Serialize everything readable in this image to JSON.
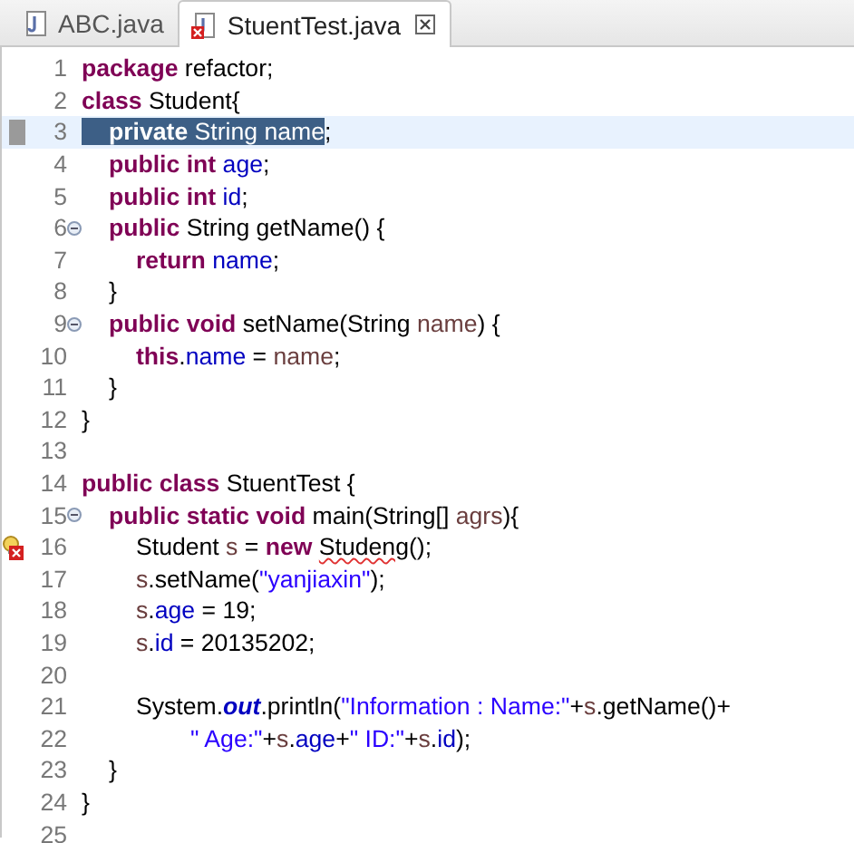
{
  "tabs": [
    {
      "label": "ABC.java",
      "selected": false,
      "error": false,
      "closable": false
    },
    {
      "label": "StuentTest.java",
      "selected": true,
      "error": true,
      "closable": true
    }
  ],
  "lines": [
    {
      "number": "1",
      "tokens": [
        {
          "kind": "kw",
          "text": "package"
        },
        {
          "kind": "plain",
          "text": " refactor;"
        }
      ]
    },
    {
      "number": "2",
      "tokens": [
        {
          "kind": "kw",
          "text": "class"
        },
        {
          "kind": "plain",
          "text": " Student{"
        }
      ]
    },
    {
      "number": "3",
      "marker": {
        "kind": "occurrence"
      },
      "current": true,
      "selection": [
        {
          "kind": "kw",
          "text": "\tprivate"
        },
        {
          "kind": "plain",
          "text": " String "
        },
        {
          "kind": "field",
          "text": "name"
        }
      ],
      "tokens": [
        {
          "kind": "plain",
          "text": ";"
        }
      ]
    },
    {
      "number": "4",
      "tokens": [
        {
          "kind": "kw",
          "text": "\tpublic int "
        },
        {
          "kind": "field",
          "text": "age"
        },
        {
          "kind": "plain",
          "text": ";"
        }
      ]
    },
    {
      "number": "5",
      "tokens": [
        {
          "kind": "kw",
          "text": "\tpublic int "
        },
        {
          "kind": "field",
          "text": "id"
        },
        {
          "kind": "plain",
          "text": ";"
        }
      ]
    },
    {
      "number": "6",
      "fold": true,
      "tokens": [
        {
          "kind": "kw",
          "text": "\tpublic"
        },
        {
          "kind": "plain",
          "text": " String getName() {"
        }
      ]
    },
    {
      "number": "7",
      "tokens": [
        {
          "kind": "kw",
          "text": "\t\treturn "
        },
        {
          "kind": "field",
          "text": "name"
        },
        {
          "kind": "plain",
          "text": ";"
        }
      ]
    },
    {
      "number": "8",
      "tokens": [
        {
          "kind": "plain",
          "text": "\t}"
        }
      ]
    },
    {
      "number": "9",
      "fold": true,
      "tokens": [
        {
          "kind": "kw",
          "text": "\tpublic void"
        },
        {
          "kind": "plain",
          "text": " setName(String "
        },
        {
          "kind": "local",
          "text": "name"
        },
        {
          "kind": "plain",
          "text": ") {"
        }
      ]
    },
    {
      "number": "10",
      "tokens": [
        {
          "kind": "kw",
          "text": "\t\tthis"
        },
        {
          "kind": "plain",
          "text": "."
        },
        {
          "kind": "field",
          "text": "name"
        },
        {
          "kind": "plain",
          "text": " = "
        },
        {
          "kind": "local",
          "text": "name"
        },
        {
          "kind": "plain",
          "text": ";"
        }
      ]
    },
    {
      "number": "11",
      "tokens": [
        {
          "kind": "plain",
          "text": "\t}"
        }
      ]
    },
    {
      "number": "12",
      "tokens": [
        {
          "kind": "plain",
          "text": "}"
        }
      ]
    },
    {
      "number": "13"
    },
    {
      "number": "14",
      "tokens": [
        {
          "kind": "kw",
          "text": "public class"
        },
        {
          "kind": "plain",
          "text": " StuentTest {"
        }
      ]
    },
    {
      "number": "15",
      "fold": true,
      "tokens": [
        {
          "kind": "kw",
          "text": "\tpublic static void"
        },
        {
          "kind": "plain",
          "text": " main(String[] "
        },
        {
          "kind": "local",
          "text": "agrs"
        },
        {
          "kind": "plain",
          "text": "){"
        }
      ]
    },
    {
      "number": "16",
      "marker": {
        "kind": "error"
      },
      "tokens": [
        {
          "kind": "plain",
          "text": "\t\tStudent "
        },
        {
          "kind": "local",
          "text": "s"
        },
        {
          "kind": "plain",
          "text": " = "
        },
        {
          "kind": "kw",
          "text": "new "
        },
        {
          "kind": "error",
          "text": "Studeng"
        },
        {
          "kind": "plain",
          "text": "();"
        }
      ]
    },
    {
      "number": "17",
      "tokens": [
        {
          "kind": "local",
          "text": "\t\ts"
        },
        {
          "kind": "plain",
          "text": ".setName("
        },
        {
          "kind": "str",
          "text": "\"yanjiaxin\""
        },
        {
          "kind": "plain",
          "text": ");"
        }
      ]
    },
    {
      "number": "18",
      "tokens": [
        {
          "kind": "local",
          "text": "\t\ts"
        },
        {
          "kind": "plain",
          "text": "."
        },
        {
          "kind": "field",
          "text": "age"
        },
        {
          "kind": "plain",
          "text": " = 19;"
        }
      ]
    },
    {
      "number": "19",
      "tokens": [
        {
          "kind": "local",
          "text": "\t\ts"
        },
        {
          "kind": "plain",
          "text": "."
        },
        {
          "kind": "field",
          "text": "id"
        },
        {
          "kind": "plain",
          "text": " = 20135202;"
        }
      ]
    },
    {
      "number": "20"
    },
    {
      "number": "21",
      "tokens": [
        {
          "kind": "plain",
          "text": "\t\tSystem."
        },
        {
          "kind": "static",
          "text": "out"
        },
        {
          "kind": "plain",
          "text": ".println("
        },
        {
          "kind": "str",
          "text": "\"Information : Name:\""
        },
        {
          "kind": "plain",
          "text": "+"
        },
        {
          "kind": "local",
          "text": "s"
        },
        {
          "kind": "plain",
          "text": ".getName()+"
        }
      ]
    },
    {
      "number": "22",
      "tokens": [
        {
          "kind": "str",
          "text": "\t\t\t\t\" Age:\""
        },
        {
          "kind": "plain",
          "text": "+"
        },
        {
          "kind": "local",
          "text": "s"
        },
        {
          "kind": "plain",
          "text": "."
        },
        {
          "kind": "field",
          "text": "age"
        },
        {
          "kind": "plain",
          "text": "+"
        },
        {
          "kind": "str",
          "text": "\" ID:\""
        },
        {
          "kind": "plain",
          "text": "+"
        },
        {
          "kind": "local",
          "text": "s"
        },
        {
          "kind": "plain",
          "text": "."
        },
        {
          "kind": "field",
          "text": "id"
        },
        {
          "kind": "plain",
          "text": ");"
        }
      ]
    },
    {
      "number": "23",
      "tokens": [
        {
          "kind": "plain",
          "text": "\t}"
        }
      ]
    },
    {
      "number": "24",
      "tokens": [
        {
          "kind": "plain",
          "text": "}"
        }
      ]
    },
    {
      "number": "25"
    }
  ]
}
